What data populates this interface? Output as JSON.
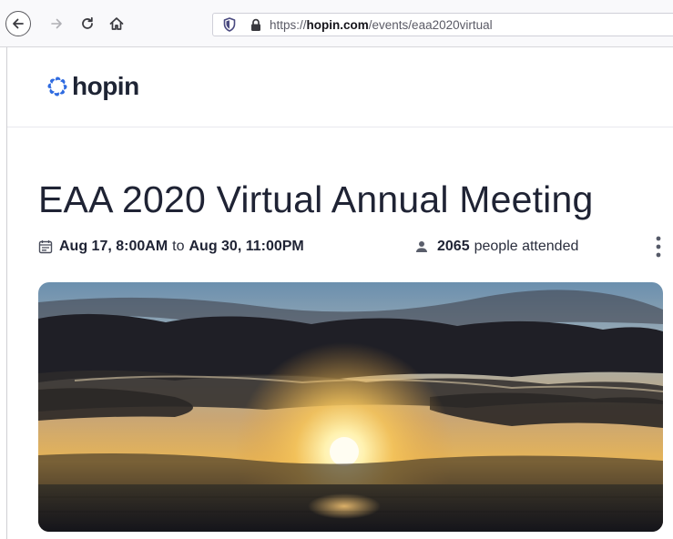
{
  "browser": {
    "url_scheme": "https://",
    "url_domain": "hopin.com",
    "url_path": "/events/eaa2020virtual"
  },
  "site": {
    "logo_text": "hopin"
  },
  "event": {
    "title": "EAA 2020 Virtual Annual Meeting",
    "start": "Aug 17, 8:00AM",
    "to_word": "to",
    "end": "Aug 30, 11:00PM",
    "attendees_count": "2065",
    "attendees_label": "people attended"
  },
  "icons": {
    "back": "back-arrow-icon",
    "forward": "forward-arrow-icon",
    "reload": "reload-icon",
    "home": "home-icon",
    "tracking": "shield-icon",
    "secure": "lock-icon",
    "calendar": "calendar-icon",
    "person": "person-icon",
    "more": "more-vertical-icon"
  },
  "colors": {
    "brand_blue": "#2f6be0",
    "text_dark": "#1f2334"
  }
}
